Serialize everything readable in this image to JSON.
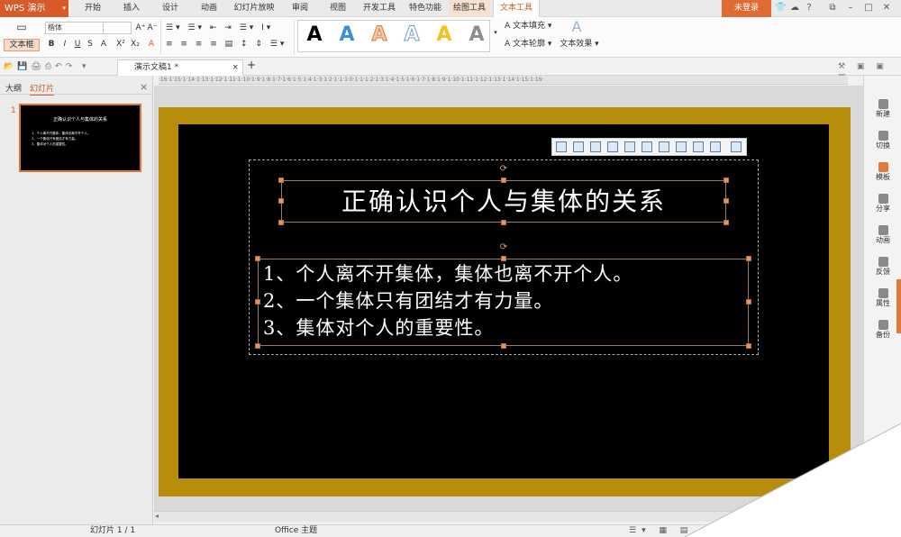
{
  "app": {
    "name": "WPS 演示",
    "login_label": "未登录",
    "help_label": "?"
  },
  "menu": {
    "tabs": [
      "开始",
      "插入",
      "设计",
      "动画",
      "幻灯片放映",
      "审阅",
      "视图",
      "开发工具",
      "特色功能",
      "绘图工具",
      "文本工具"
    ],
    "active": "文本工具"
  },
  "ribbon": {
    "textbox_label": "文本框",
    "font_name": "楷体",
    "font_size": "",
    "bold": "B",
    "italic": "I",
    "underline": "U",
    "strike": "S",
    "shadow": "A",
    "superscript": "X²",
    "subscript": "X₂",
    "art_letters": [
      "A",
      "A",
      "A",
      "A",
      "A",
      "A"
    ],
    "text_fill_label": "文本填充",
    "text_outline_label": "文本轮廓",
    "text_effect_label": "文本效果"
  },
  "document": {
    "tab_title": "演示文稿1 *",
    "close_label": "×",
    "add_label": "+"
  },
  "left_panel": {
    "tabs": [
      "大纲",
      "幻灯片"
    ],
    "active_tab": "幻灯片",
    "close_label": "×",
    "slide_number": "1"
  },
  "ruler_labels": "·16·1·15·1·14·1·13·1·12·1·11·1·10·1·9·1·8·1·7·1·6·1·5·1·4·1·3·1·2·1·1·1·0·1·1·1·2·1·3·1·4·1·5·1·6·1·7·1·8·1·9·1·10·1·11·1·12·1·13·1·14·1·15·1·16·",
  "slide": {
    "title": "正确认识个人与集体的关系",
    "lines": [
      "1、个人离不开集体，集体也离不开个人。",
      "2、一个集体只有团结才有力量。",
      "3、集体对个人的重要性。"
    ],
    "thumb_title": "正确认识个人与集体的关系",
    "thumb_lines": [
      "1、个人离不开集体，集体也离不开个人。",
      "2、一个集体只有团结才有力量。",
      "3、集体对个人的重要性。"
    ]
  },
  "right_sidebar": {
    "items": [
      "新建",
      "切换",
      "模板",
      "分享",
      "动画",
      "反馈",
      "属性",
      "备份"
    ]
  },
  "statusbar": {
    "slide_count": "幻灯片 1 / 1",
    "theme": "Office 主题"
  },
  "colors": {
    "accent": "#d75a28",
    "slide_bg": "#000000",
    "slide_frame": "#b88d0c",
    "handle": "#e29668"
  },
  "icons": [
    "menu-arrow-icon",
    "shirt-icon",
    "chat-icon",
    "help-icon",
    "minimize-icon",
    "restore-icon",
    "close-icon",
    "open-icon",
    "save-icon",
    "print-icon",
    "undo-icon",
    "redo-icon",
    "wordart-icon",
    "rotate-icon",
    "align-icon",
    "sidebar-icon"
  ]
}
